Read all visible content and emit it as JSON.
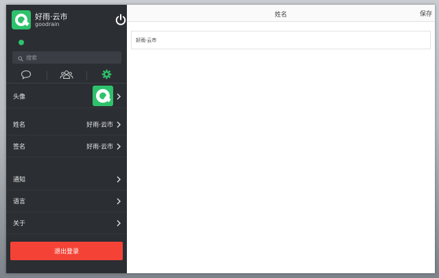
{
  "sidebar": {
    "profile": {
      "name": "好雨·云市",
      "account": "goodrain"
    },
    "search": {
      "placeholder": "搜索"
    },
    "rows": [
      {
        "label": "头像"
      },
      {
        "label": "姓名",
        "value": "好雨·云市"
      },
      {
        "label": "签名",
        "value": "好雨·云市"
      },
      {
        "label": "通知"
      },
      {
        "label": "语言"
      },
      {
        "label": "关于"
      }
    ],
    "logout_label": "退出登录"
  },
  "main": {
    "title": "姓名",
    "save_label": "保存",
    "name_value": "好雨·云市"
  },
  "colors": {
    "accent_green": "#2ec26c",
    "logout_red": "#f44336",
    "sidebar_bg": "#2b2e33"
  },
  "icons": [
    "power-icon",
    "search-icon",
    "chat-bubble-icon",
    "contacts-icon",
    "gear-icon",
    "chevron-right-icon"
  ]
}
